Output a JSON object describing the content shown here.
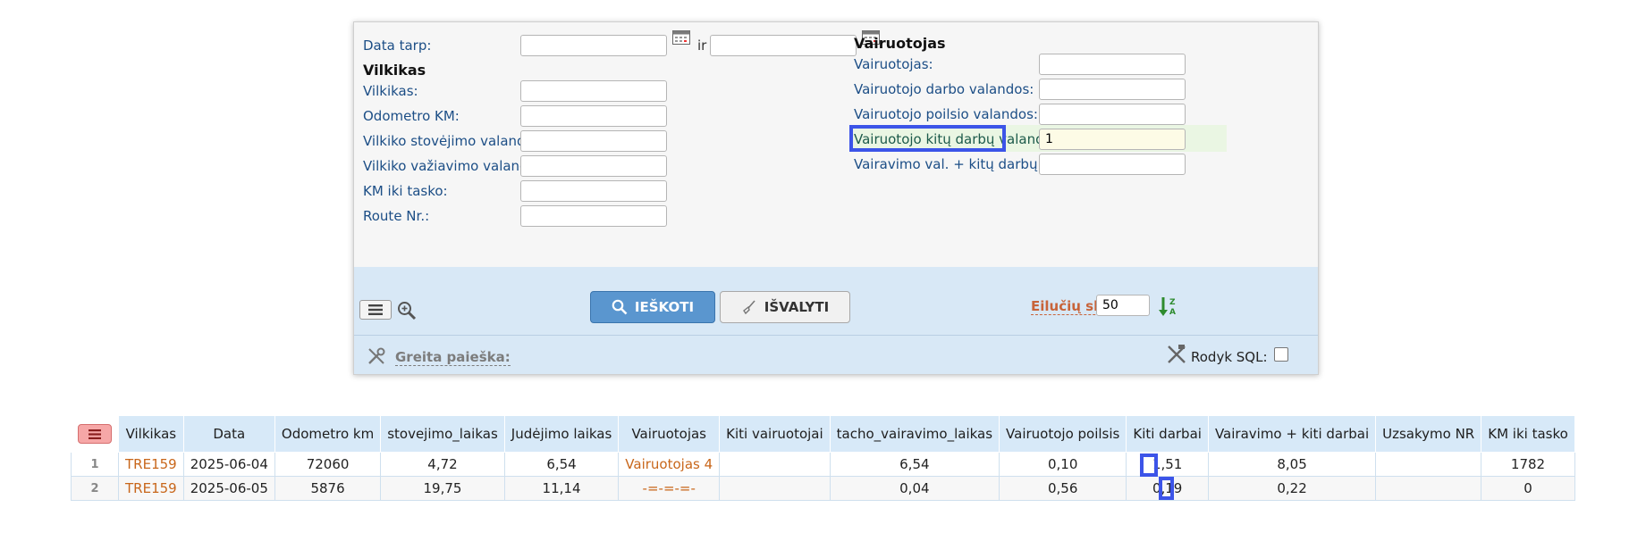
{
  "filter": {
    "date_label": "Data tarp:",
    "date_from": "",
    "date_to": "",
    "date_joiner": "ir",
    "truck_section": "Vilkikas",
    "truck_fields": [
      {
        "label": "Vilkikas:",
        "value": ""
      },
      {
        "label": "Odometro KM:",
        "value": ""
      },
      {
        "label": "Vilkiko stovėjimo valandos:",
        "value": ""
      },
      {
        "label": "Vilkiko važiavimo valandos:",
        "value": ""
      },
      {
        "label": "KM iki tasko:",
        "value": ""
      },
      {
        "label": "Route Nr.:",
        "value": ""
      }
    ],
    "driver_section": "Vairuotojas",
    "driver_fields": [
      {
        "label": "Vairuotojas:",
        "value": ""
      },
      {
        "label": "Vairuotojo darbo valandos:",
        "value": ""
      },
      {
        "label": "Vairuotojo poilsio valandos:",
        "value": ""
      },
      {
        "label": "Vairuotojo kitų darbų valandos:",
        "value": "1"
      },
      {
        "label": "Vairavimo val. + kitų darbų val.:",
        "value": ""
      }
    ]
  },
  "actions": {
    "search_label": "IEŠKOTI",
    "clear_label": "IŠVALYTI",
    "rows_label": "Eilučių sk.:",
    "rows_value": "50",
    "quick_search_label": "Greita paieška:",
    "show_sql_label": "Rodyk SQL:",
    "show_sql_checked": false
  },
  "table": {
    "columns": [
      "Vilkikas",
      "Data",
      "Odometro km",
      "stovejimo_laikas",
      "Judėjimo laikas",
      "Vairuotojas",
      "Kiti vairuotojai",
      "tacho_vairavimo_laikas",
      "Vairuotojo poilsis",
      "Kiti darbai",
      "Vairavimo + kiti darbai",
      "Uzsakymo NR",
      "KM iki tasko"
    ],
    "rows": [
      {
        "n": "1",
        "cells": [
          "TRE159",
          "2025-06-04",
          "72060",
          "4,72",
          "6,54",
          "Vairuotojas 4",
          "",
          "6,54",
          "0,10",
          "1,51",
          "8,05",
          "",
          "1782"
        ]
      },
      {
        "n": "2",
        "cells": [
          "TRE159",
          "2025-06-05",
          "5876",
          "19,75",
          "11,14",
          "-=-=-=-",
          "",
          "0,04",
          "0,56",
          "0,19",
          "0,22",
          "",
          "0"
        ]
      }
    ]
  },
  "colors": {
    "accent": "#5a96cf",
    "link": "#c8661a",
    "label": "#1c4e86",
    "highlight": "#3c54e8"
  }
}
